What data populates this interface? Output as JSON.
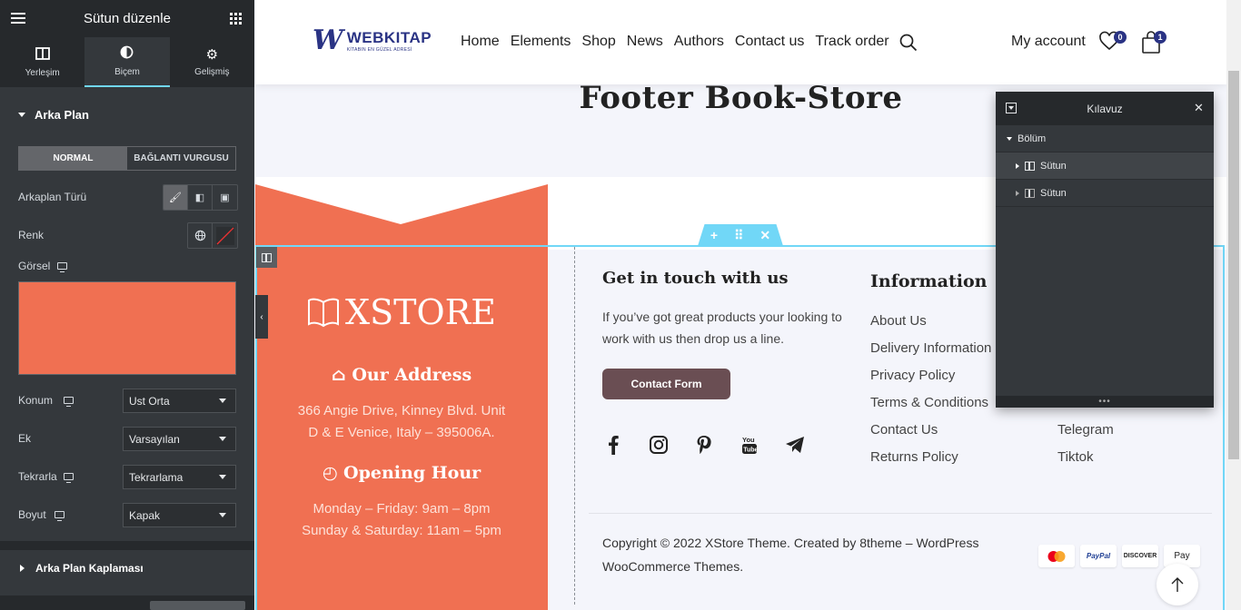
{
  "panel": {
    "title": "Sütun düzenle",
    "tabs": [
      {
        "label": "Yerleşim",
        "icon": "layout-icon"
      },
      {
        "label": "Biçem",
        "icon": "contrast-icon"
      },
      {
        "label": "Gelişmiş",
        "icon": "gear-icon"
      }
    ],
    "background_section": "Arka Plan",
    "state_tabs": [
      "NORMAL",
      "BAĞLANTI VURGUSU"
    ],
    "bg_type_label": "Arkaplan Türü",
    "color_label": "Renk",
    "image_label": "Görsel",
    "swatch_color": "#f07052",
    "fields": [
      {
        "label": "Konum",
        "value": "Ust Orta"
      },
      {
        "label": "Ek",
        "value": "Varsayılan"
      },
      {
        "label": "Tekrarla",
        "value": "Tekrarlama"
      },
      {
        "label": "Boyut",
        "value": "Kapak"
      }
    ],
    "overlay_section": "Arka Plan Kaplaması"
  },
  "site": {
    "logo_name": "WEBKITAP",
    "logo_tag": "KİTABIN EN GÜZEL ADRESİ",
    "nav": [
      "Home",
      "Elements",
      "Shop",
      "News",
      "Authors",
      "Contact us",
      "Track order"
    ],
    "my_account": "My account",
    "wishlist_count": "0",
    "cart_count": "1",
    "page_title": "Footer Book-Store",
    "brand": "XSTORE",
    "address_heading": "Our Address",
    "address": "366 Angie Drive, Kinney Blvd. Unit D & E Venice, Italy – 395006A.",
    "hours_heading": "Opening Hour",
    "hours_line1": "Monday – Friday: 9am – 8pm",
    "hours_line2": "Sunday & Saturday: 11am – 5pm",
    "contact_heading": "Get in touch with us",
    "contact_text": "If you’ve got great products your looking to work with us then drop us a line.",
    "contact_button": "Contact Form",
    "info_heading": "Information",
    "info_links": [
      "About Us",
      "Delivery Information",
      "Privacy Policy",
      "Terms & Conditions",
      "Contact Us",
      "Returns Policy"
    ],
    "extra_links": [
      "Telegram",
      "Tiktok"
    ],
    "copyright": "Copyright © 2022 XStore Theme. Created by 8theme – WordPress WooCommerce Themes.",
    "payments": [
      "Mastercard",
      "PayPal",
      "DISCOVER",
      "Apple Pay"
    ],
    "accent": "#f07052",
    "button_color": "#6a4e53"
  },
  "navigator": {
    "title": "Kılavuz",
    "section": "Bölüm",
    "columns": [
      "Sütun",
      "Sütun"
    ]
  }
}
